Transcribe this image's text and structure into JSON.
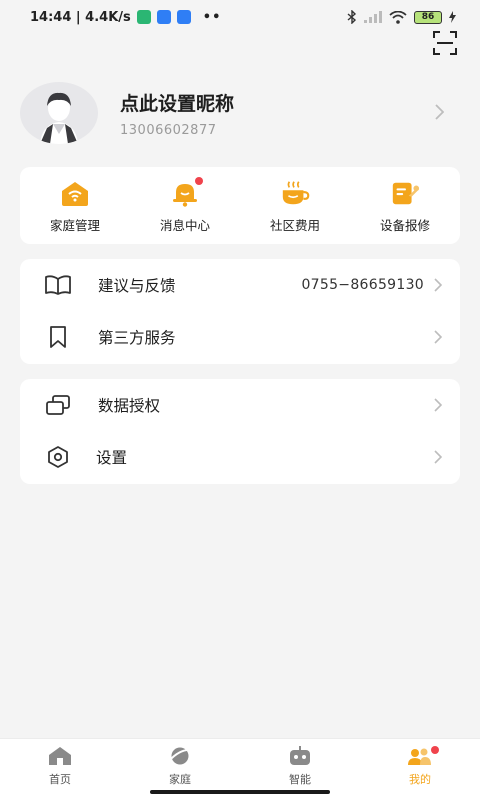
{
  "status": {
    "time_speed": "14:44 | 4.4K/s",
    "dots": "••",
    "battery": "86"
  },
  "profile": {
    "nickname": "点此设置昵称",
    "phone": "13006602877"
  },
  "quick_actions": [
    {
      "label": "家庭管理",
      "icon": "wifi-home-icon",
      "badge": false
    },
    {
      "label": "消息中心",
      "icon": "bell-icon",
      "badge": true
    },
    {
      "label": "社区费用",
      "icon": "coffee-cup-icon",
      "badge": false
    },
    {
      "label": "设备报修",
      "icon": "repair-form-icon",
      "badge": false
    }
  ],
  "menu_group_1": [
    {
      "label": "建议与反馈",
      "value": "0755−86659130",
      "icon": "book-open-icon"
    },
    {
      "label": "第三方服务",
      "value": "",
      "icon": "bookmark-icon"
    }
  ],
  "menu_group_2": [
    {
      "label": "数据授权",
      "icon": "layers-icon"
    },
    {
      "label": "设置",
      "icon": "hexagon-settings-icon"
    }
  ],
  "bottom_nav": [
    {
      "label": "首页",
      "icon": "home-icon",
      "active": false
    },
    {
      "label": "家庭",
      "icon": "planet-icon",
      "active": false
    },
    {
      "label": "智能",
      "icon": "robot-icon",
      "active": false
    },
    {
      "label": "我的",
      "icon": "user-group-icon",
      "active": true
    }
  ],
  "colors": {
    "accent": "#f3a51c",
    "badge": "#f0434c",
    "background": "#f4f4f4"
  }
}
